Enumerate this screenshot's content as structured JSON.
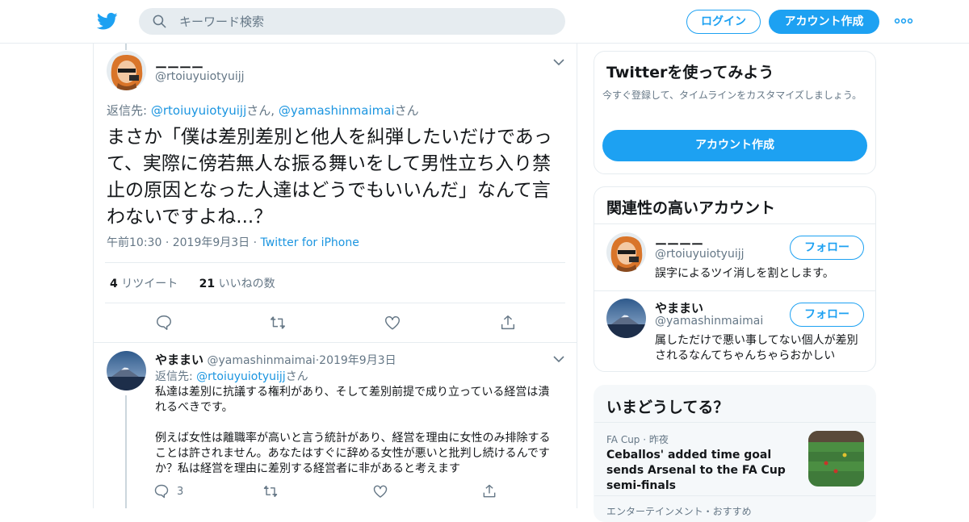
{
  "header": {
    "search_placeholder": "キーワード検索",
    "login_label": "ログイン",
    "signup_label": "アカウント作成",
    "accent_color": "#1da1f2"
  },
  "focus_tweet": {
    "display_name": "ーーーー",
    "handle": "@rtoiuyuiotyuijj",
    "reply_prefix": "返信先:",
    "reply_to_1": "@rtoiuyuiotyuijj",
    "reply_suffix_1": "さん,",
    "reply_to_2": "@yamashinmaimai",
    "reply_suffix_2": "さん",
    "text": "まさか「僕は差別差別と他人を糾弾したいだけであって、実際に傍若無人な振る舞いをして男性立ち入り禁止の原因となった人達はどうでもいいんだ」なんて言わないですよね...？",
    "time": "午前10:30",
    "date": "2019年9月3日",
    "source": "Twitter for iPhone",
    "retweet_count": "4",
    "retweet_label": "リツイート",
    "like_count": "21",
    "like_label": "いいねの数"
  },
  "reply_tweet": {
    "display_name": "やままい",
    "handle": "@yamashinmaimai",
    "date": "2019年9月3日",
    "reply_prefix": "返信先:",
    "reply_to": "@rtoiuyuiotyuijj",
    "reply_suffix": "さん",
    "para1": "私達は差別に抗議する権利があり、そして差別前提で成り立っている経営は潰れるべきです。",
    "para2": "例えば女性は離職率が高いと言う統計があり、経営を理由に女性のみ排除することは許されません。あなたはすぐに辞める女性が悪いと批判し続けるんですか？私は経営を理由に差別する経営者に非があると考えます",
    "reply_count": "3"
  },
  "sidebar": {
    "try_card": {
      "title": "Twitterを使ってみよう",
      "subtitle": "今すぐ登録して、タイムラインをカスタマイズしましょう。",
      "button": "アカウント作成"
    },
    "related_card": {
      "title": "関連性の高いアカウント",
      "accounts": [
        {
          "name": "ーーーー",
          "handle": "@rtoiuyuiotyuijj",
          "bio": "誤字によるツイ消しを割とします。",
          "follow": "フォロー"
        },
        {
          "name": "やままい",
          "handle": "@yamashinmaimai",
          "bio": "属しただけで悪い事してない個人が差別されるなんてちゃんちゃらおかしい",
          "follow": "フォロー"
        }
      ]
    },
    "trends_card": {
      "title": "いまどうしてる？",
      "item": {
        "category": "FA Cup",
        "time": "昨夜",
        "headline": "Ceballos' added time goal sends Arsenal to the FA Cup semi-finals"
      },
      "next_partial": "エンターテインメント・おすすめ"
    }
  }
}
